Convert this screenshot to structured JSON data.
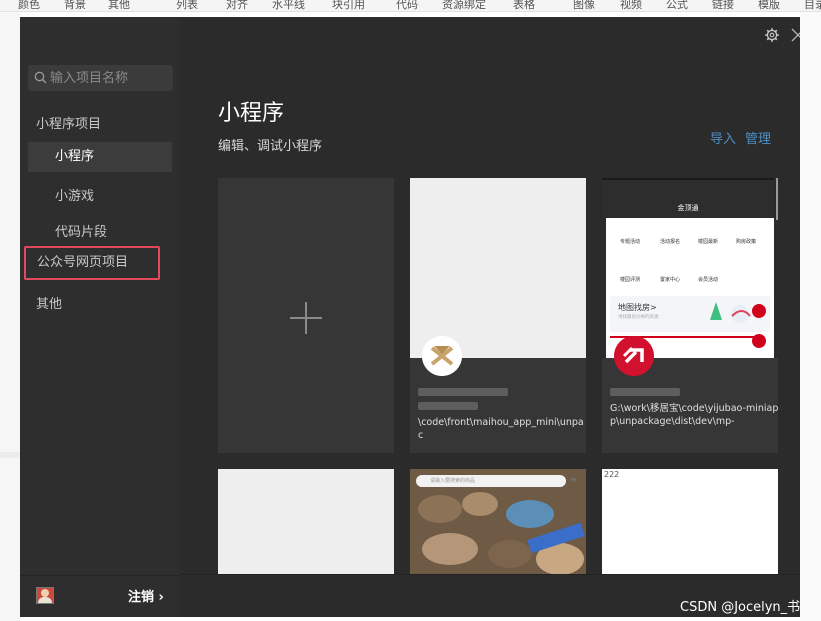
{
  "background_menu": {
    "items": [
      "颜色",
      "背景",
      "其他",
      "列表",
      "对齐",
      "水平线",
      "块引用",
      "代码",
      "资源绑定",
      "表格",
      "图像",
      "视频",
      "公式",
      "链接",
      "模版",
      "目录"
    ]
  },
  "sidebar": {
    "search_placeholder": "输入项目名称",
    "sections": [
      {
        "label": "小程序项目"
      },
      {
        "label": "小程序",
        "active": true
      },
      {
        "label": "小游戏"
      },
      {
        "label": "代码片段"
      },
      {
        "label": "公众号网页项目",
        "highlighted": true
      },
      {
        "label": "其他"
      }
    ],
    "footer": {
      "logout_label": "注销 ›"
    }
  },
  "header": {
    "title": "小程序",
    "subtitle": "编辑、调试小程序",
    "import_label": "导入",
    "manage_label": "管理"
  },
  "projects": [
    {
      "path": "\\code\\front\\maihou_app_mini\\unpac"
    },
    {
      "path": "G:\\work\\移居宝\\code\\yijubao-miniapp\\unpackage\\dist\\dev\\mp-",
      "thumb_title": "金顶通",
      "thumb_menu": [
        "专题活动",
        "活动报名",
        "楼园最新",
        "购房政策",
        "楼园评测",
        "置家中心",
        "会员活动"
      ],
      "thumb_banner_title": "地图找房>",
      "thumb_banner_sub": "寻找最优价格的房源"
    }
  ],
  "bottom_cards": [
    {},
    {
      "thumb_search": "请输入要搜索的商品"
    },
    {
      "thumb_label": "222"
    }
  ],
  "watermark": "CSDN @Jocelyn_书",
  "colors": {
    "dialog_bg": "#2b2b2b",
    "sidebar_bg": "#2e2e2e",
    "highlight_border": "#e04a5c",
    "link": "#4e8fc7"
  }
}
